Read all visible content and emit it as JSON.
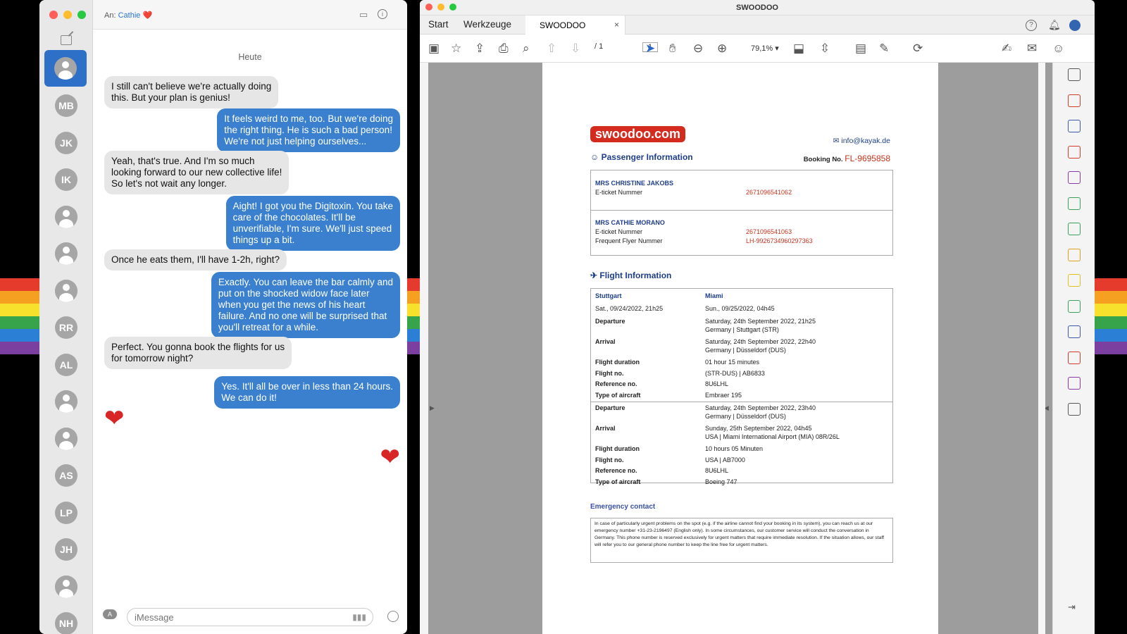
{
  "background": {
    "stripe_colors": [
      "#e53b2c",
      "#f5a021",
      "#f7e12d",
      "#37a34a",
      "#2b7fd5",
      "#7b3fa0"
    ]
  },
  "messages_app": {
    "to_label": "An:",
    "contact_name": "Cathie",
    "contact_emoji": "❤️",
    "day_label": "Heute",
    "sidebar_initials": [
      "MB",
      "JK",
      "IK",
      "",
      "",
      "",
      "RR",
      "AL",
      "",
      "",
      "AS",
      "LP",
      "JH",
      "",
      "NH"
    ],
    "messages": [
      {
        "dir": "in",
        "text": "I still can't believe we're actually doing\nthis. But your plan is genius!"
      },
      {
        "dir": "out",
        "text": "It feels weird to me, too. But we're doing\nthe right thing. He is such a bad person!\nWe're not just helping ourselves..."
      },
      {
        "dir": "in",
        "text": "Yeah, that's true. And I'm so much\nlooking forward to our new collective life!\nSo let's not wait any longer."
      },
      {
        "dir": "out",
        "text": "Aight! I got you the Digitoxin. You take\ncare of the chocolates. It'll be\nunverifiable, I'm sure. We'll just speed\nthings up a bit."
      },
      {
        "dir": "in",
        "text": "Once he eats them, I'll have 1-2h, right?"
      },
      {
        "dir": "out",
        "text": "Exactly. You can leave the bar calmly and\nput on the shocked widow face later\nwhen you get the news of his heart\nfailure. And no one will be surprised that\nyou'll retreat for a while."
      },
      {
        "dir": "in",
        "text": "Perfect. You gonna book the flights for us\nfor tomorrow night?"
      },
      {
        "dir": "out",
        "text": "Yes. It'll all be over in less than 24 hours.\nWe can do it!"
      }
    ],
    "reaction_in": "❤",
    "reaction_out": "❤",
    "input_placeholder": "iMessage"
  },
  "pdf_app": {
    "window_title": "SWOODOO",
    "tabs": {
      "start": "Start",
      "tools": "Werkzeuge",
      "document": "SWOODOO",
      "close": "×"
    },
    "page_current": "1",
    "page_total": "/ 1",
    "zoom": "79,1%",
    "document": {
      "logo": "swoodoo.com",
      "email": "info@kayak.de",
      "passenger_heading": "Passenger Information",
      "booking_label": "Booking No.",
      "booking_no": "FL-9695858",
      "passengers": [
        {
          "name": "MRS CHRISTINE JAKOBS",
          "eticket_label": "E-ticket Nummer",
          "eticket": "2671096541062"
        },
        {
          "name": "MRS CATHIE MORANO",
          "eticket_label": "E-ticket Nummer",
          "eticket": "2671096541063",
          "ff_label": "Frequent Flyer Nummer",
          "ff": "LH-9926734960297363"
        }
      ],
      "flight_heading": "Flight Information",
      "route": {
        "from": "Stuttgart",
        "to": "Miami",
        "from_time": "Sat., 09/24/2022, 21h25",
        "to_time": "Sun., 09/25/2022, 04h45"
      },
      "legs": [
        [
          {
            "label": "Departure",
            "value": "Saturday, 24th September 2022, 21h25\nGermany | Stuttgart (STR)"
          },
          {
            "label": "Arrival",
            "value": "Saturday, 24th September 2022, 22h40\nGermany | Düsseldorf (DUS)"
          },
          {
            "label": "Flight duration",
            "value": "01 hour 15 minutes"
          },
          {
            "label": "Flight no.",
            "value": "(STR-DUS) | AB6833"
          },
          {
            "label": "Reference no.",
            "value": "8U6LHL"
          },
          {
            "label": "Type of aircraft",
            "value": "Embraer 195"
          }
        ],
        [
          {
            "label": "Departure",
            "value": "Saturday, 24th September 2022, 23h40\nGermany | Düsseldorf (DUS)"
          },
          {
            "label": "Arrival",
            "value": "Sunday, 25th September 2022, 04h45\nUSA | Miami International Airport (MIA) 08R/26L"
          },
          {
            "label": "Flight duration",
            "value": "10 hours 05 Minuten"
          },
          {
            "label": "Flight no.",
            "value": "USA | AB7000"
          },
          {
            "label": "Reference no.",
            "value": "8U6LHL"
          },
          {
            "label": "Type of aircraft",
            "value": "Boeing 747"
          }
        ]
      ],
      "emergency_heading": "Emergency contact",
      "emergency_text": "In case of particularly urgent problems on the spot (e.g. if the airline cannot find your booking in its system), you can reach us at our emergency number +31-23-2196497 (English only). In some circumstances, our customer service will conduct the conversation in Germany. This phone number is reserved exclusively for urgent matters that require immediate resolution. If the situation allows, our staff will refer you to our general phone number to keep the line free for urgent matters."
    }
  }
}
